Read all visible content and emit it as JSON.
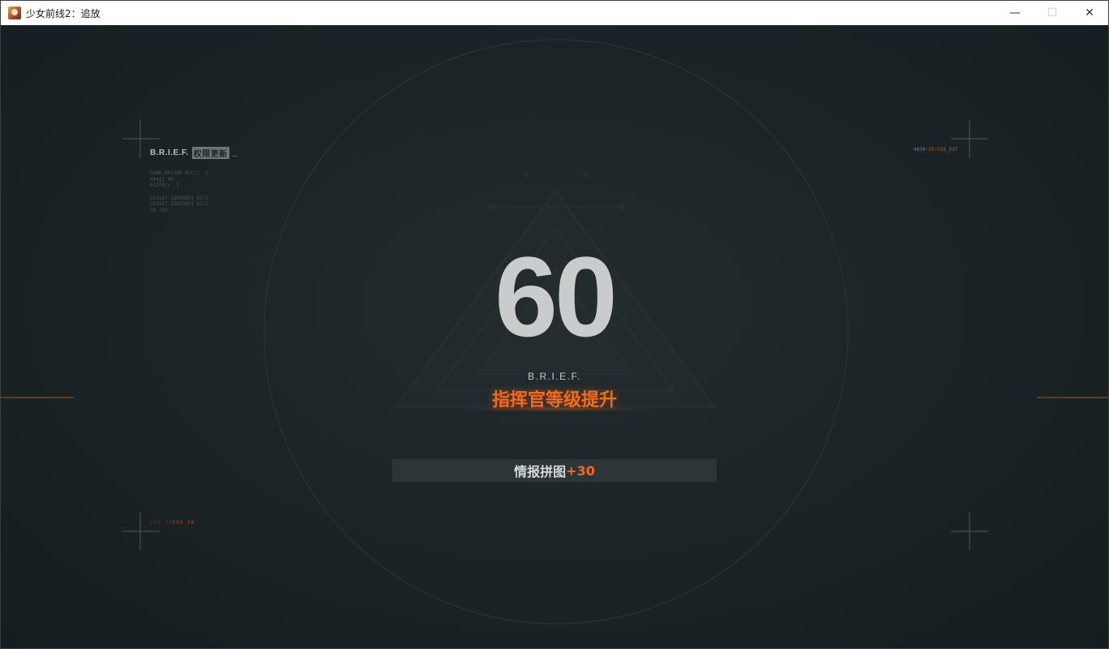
{
  "window": {
    "title": "少女前线2：追放",
    "icon": "app-portrait-icon",
    "controls": {
      "minimize": "—",
      "maximize": "☐",
      "close": "✕"
    }
  },
  "hud": {
    "top_left": {
      "brief": "B.R.I.E.F.",
      "auth_tag": "权限更新",
      "cursor": "_",
      "code_lines_1": "YAAD 9013DE ECC// .C\n09421 08\n012FR// .1",
      "code_lines_2": "CDJSX7 338FDEK1 8271\nCDJSX7 338FDEK1 8271\n28 768"
    },
    "top_right": {
      "code_a": "4030-",
      "code_b": "33-533",
      "code_c": "_537"
    },
    "bottom_left": {
      "code": "///    //EOS X0"
    }
  },
  "levelup": {
    "level": "60",
    "brief": "B.R.I.E.F.",
    "title": "指挥官等级提升",
    "reward_label": "情报拼图",
    "reward_value": "+30"
  },
  "colors": {
    "accent": "#f26a1e",
    "background": "#1c2427",
    "text": "#c9cbcc"
  }
}
